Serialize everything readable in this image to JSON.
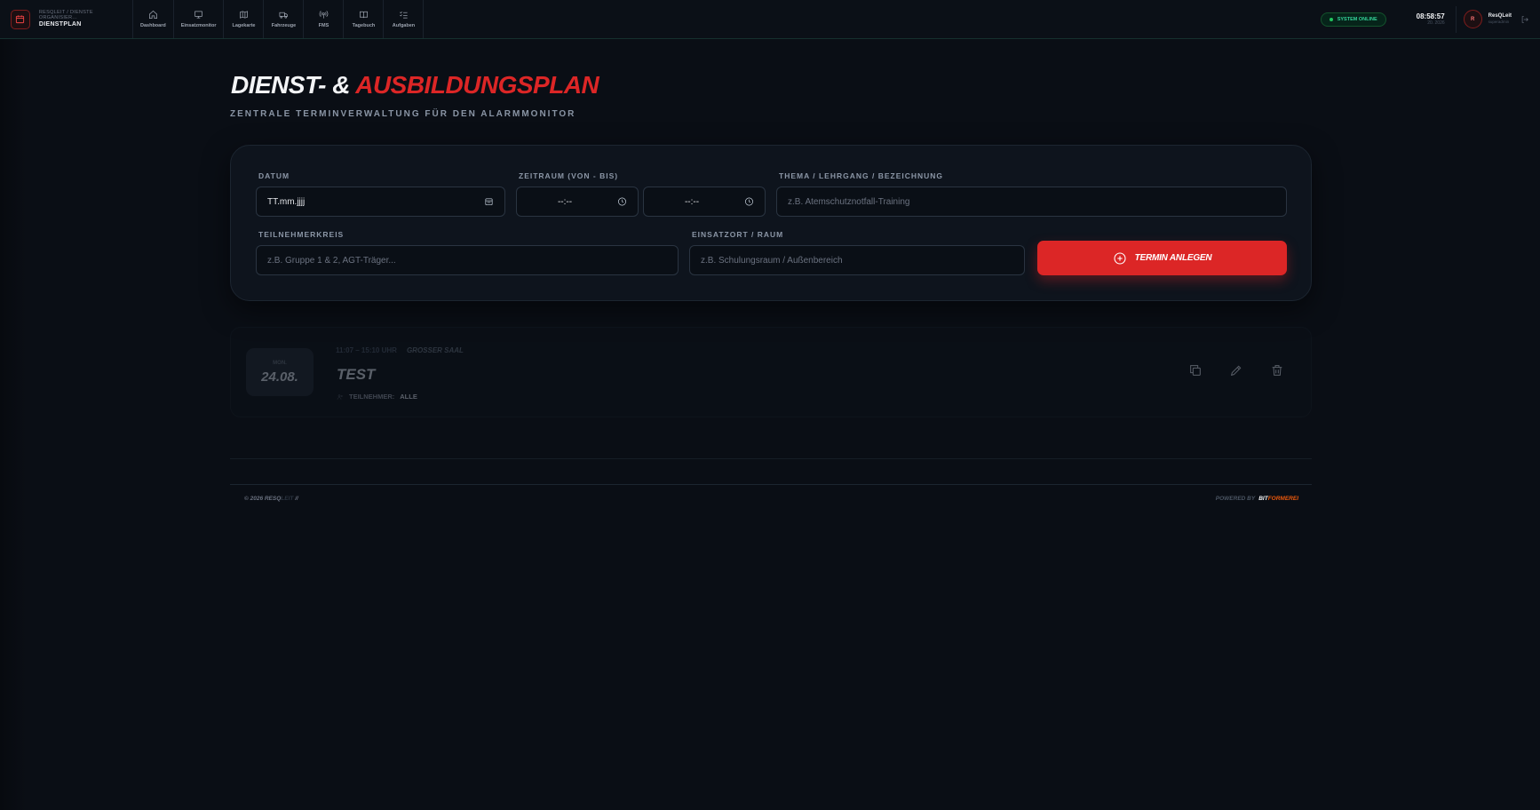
{
  "header": {
    "breadcrumb": "RESQLEIT / DIENSTE ORGANISIER...",
    "title": "DIENSTPLAN",
    "nav": [
      {
        "label": "Dashboard",
        "icon": "home-icon"
      },
      {
        "label": "Einsatzmonitor",
        "icon": "monitor-icon"
      },
      {
        "label": "Lagekarte",
        "icon": "map-icon"
      },
      {
        "label": "Fahrzeuge",
        "icon": "truck-icon"
      },
      {
        "label": "FMS",
        "icon": "radio-icon"
      },
      {
        "label": "Tagebuch",
        "icon": "book-icon"
      },
      {
        "label": "Aufgaben",
        "icon": "checklist-icon"
      }
    ],
    "status": "SYSTEM ONLINE",
    "time": "08:58:57",
    "date": "20. 2026",
    "user": {
      "initial": "R",
      "name": "ResQLeit",
      "role": "superadmin"
    }
  },
  "page": {
    "title_main": "DIENST- &",
    "title_accent": "AUSBILDUNGSPLAN",
    "subtitle": "ZENTRALE TERMINVERWALTUNG FÜR DEN ALARMMONITOR"
  },
  "form": {
    "date_label": "DATUM",
    "date_value": "TT.mm.jjjj",
    "time_label": "ZEITRAUM (VON - BIS)",
    "time_from": "--:--",
    "time_to": "--:--",
    "topic_label": "THEMA / LEHRGANG / BEZEICHNUNG",
    "topic_placeholder": "z.B. Atemschutznotfall-Training",
    "participants_label": "TEILNEHMERKREIS",
    "participants_placeholder": "z.B. Gruppe 1 & 2, AGT-Träger...",
    "location_label": "EINSATZORT / RAUM",
    "location_placeholder": "z.B. Schulungsraum / Außenbereich",
    "submit_label": "TERMIN ANLEGEN"
  },
  "events": [
    {
      "weekday": "MON.",
      "date": "24.08.",
      "time": "11:07 – 15:10 UHR",
      "room": "GROSSER SAAL",
      "title": "TEST",
      "participants_label": "TEILNEHMER:",
      "participants": "ALLE"
    }
  ],
  "footer": {
    "copyright": "© 2026 RESQ",
    "copyright_dim": "LEIT",
    "copyright_tail": " //",
    "powered_by": "POWERED BY",
    "brand_a": "BIT",
    "brand_b": "FORMEREI"
  },
  "colors": {
    "accent": "#dc2626",
    "background": "#0a0e15",
    "online": "#22c55e",
    "brand_orange": "#ea580c"
  }
}
